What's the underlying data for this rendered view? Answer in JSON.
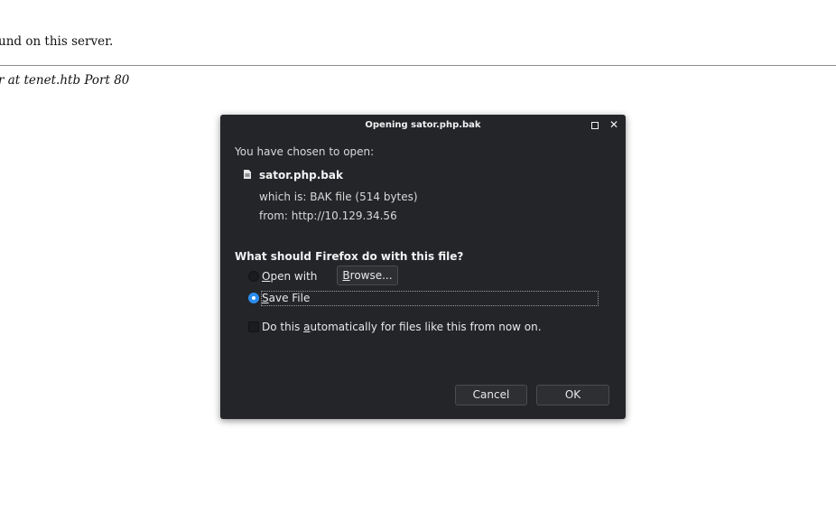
{
  "background_page": {
    "line1": "und on this server.",
    "footer": "r at tenet.htb Port 80"
  },
  "dialog": {
    "title": "Opening sator.php.bak",
    "intro": "You have chosen to open:",
    "filename": "sator.php.bak",
    "which_is": "which is:  BAK file (514 bytes)",
    "from": "from:  http://10.129.34.56",
    "question": "What should Firefox do with this file?",
    "open_with": {
      "mnemonic": "O",
      "rest": "pen with",
      "selected": false
    },
    "browse": {
      "mnemonic": "B",
      "rest": "rowse..."
    },
    "save_file": {
      "mnemonic": "S",
      "rest": "ave File",
      "selected": true
    },
    "auto": {
      "before": "Do this ",
      "mnemonic": "a",
      "after": "utomatically for files like this from now on.",
      "checked": false
    },
    "cancel_label": "Cancel",
    "ok_label": "OK"
  },
  "colors": {
    "dialog_bg": "#232529",
    "accent": "#2a8cf0",
    "button_bg": "#2d2f33"
  }
}
